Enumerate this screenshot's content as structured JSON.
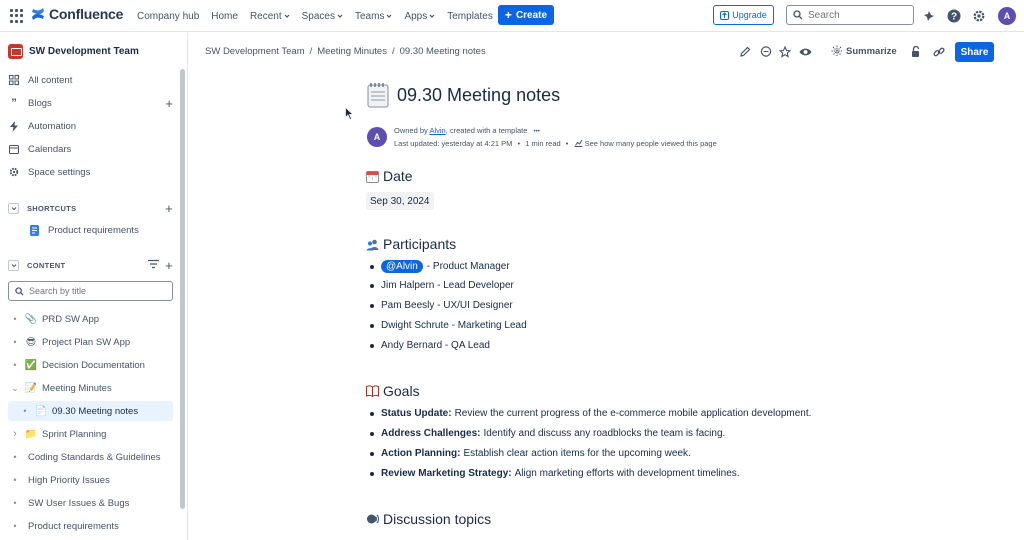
{
  "topnav": {
    "brand": "Confluence",
    "links": [
      {
        "label": "Company hub",
        "caret": false
      },
      {
        "label": "Home",
        "caret": false
      },
      {
        "label": "Recent",
        "caret": true
      },
      {
        "label": "Spaces",
        "caret": true
      },
      {
        "label": "Teams",
        "caret": true
      },
      {
        "label": "Apps",
        "caret": true
      },
      {
        "label": "Templates",
        "caret": false
      }
    ],
    "create_label": "Create",
    "upgrade_label": "Upgrade",
    "search_placeholder": "Search",
    "avatar_initial": "A"
  },
  "sidebar": {
    "space_name": "SW Development Team",
    "items": [
      {
        "label": "All content",
        "icon": "grid-icon"
      },
      {
        "label": "Blogs",
        "icon": "quote-icon"
      },
      {
        "label": "Automation",
        "icon": "lightning-icon"
      },
      {
        "label": "Calendars",
        "icon": "calendar-icon"
      },
      {
        "label": "Space settings",
        "icon": "gear-icon"
      }
    ],
    "shortcuts_label": "SHORTCUTS",
    "shortcut_item": "Product requirements",
    "content_label": "CONTENT",
    "search_placeholder": "Search by title",
    "tree": [
      {
        "label": "PRD SW App",
        "icon": "📎",
        "bullet": "•"
      },
      {
        "label": "Project Plan SW App",
        "icon": "😎",
        "bullet": "•"
      },
      {
        "label": "Decision Documentation",
        "icon": "✅",
        "bullet": "•"
      },
      {
        "label": "Meeting Minutes",
        "icon": "📝",
        "bullet": "⌄"
      },
      {
        "label": "09.30 Meeting notes",
        "icon": "📄",
        "bullet": "•"
      },
      {
        "label": "Sprint Planning",
        "icon": "📁",
        "bullet": "›"
      },
      {
        "label": "Coding Standards & Guidelines",
        "icon": "",
        "bullet": "•"
      },
      {
        "label": "High Priority Issues",
        "icon": "",
        "bullet": "•"
      },
      {
        "label": "SW User Issues & Bugs",
        "icon": "",
        "bullet": "•"
      },
      {
        "label": "Product requirements",
        "icon": "",
        "bullet": "•"
      }
    ]
  },
  "breadcrumb": [
    "SW Development Team",
    "/",
    "Meeting Minutes",
    "/",
    "09.30 Meeting notes"
  ],
  "page_actions": {
    "summarize_label": "Summarize",
    "share_label": "Share"
  },
  "page": {
    "title": "09.30 Meeting notes",
    "avatar_initial": "A",
    "owner_prefix": "Owned by ",
    "owner_name": "Alvin",
    "owner_suffix": ", created with a template",
    "owner_more": "•••",
    "last_updated": "Last updated: yesterday at 4:21 PM",
    "read_time": "1 min read",
    "views_text": "See how many people viewed this page",
    "date_heading": "Date",
    "date_value": "Sep 30, 2024",
    "participants_heading": "Participants",
    "participants": [
      {
        "mention": "@Alvin",
        "text": " - Product Manager"
      },
      {
        "mention": "",
        "text": "Jim Halpern - Lead Developer"
      },
      {
        "mention": "",
        "text": "Pam Beesly - UX/UI Designer"
      },
      {
        "mention": "",
        "text": "Dwight Schrute - Marketing Lead"
      },
      {
        "mention": "",
        "text": "Andy Bernard - QA Lead"
      }
    ],
    "goals_heading": "Goals",
    "goals": [
      {
        "bold": "Status Update:",
        "text": "Review the current progress of the e-commerce mobile application development."
      },
      {
        "bold": "Address Challenges:",
        "text": "Identify and discuss any roadblocks the team is facing."
      },
      {
        "bold": "Action Planning:",
        "text": "Establish clear action items for the upcoming week."
      },
      {
        "bold": "Review Marketing Strategy:",
        "text": "Align marketing efforts with development timelines."
      }
    ],
    "discussion_heading": "Discussion topics"
  },
  "colors": {
    "primary": "#0c66e4",
    "text": "#172b4d",
    "subtle": "#44546f",
    "avatar": "#5e4db2",
    "space_icon": "#c9372c"
  }
}
